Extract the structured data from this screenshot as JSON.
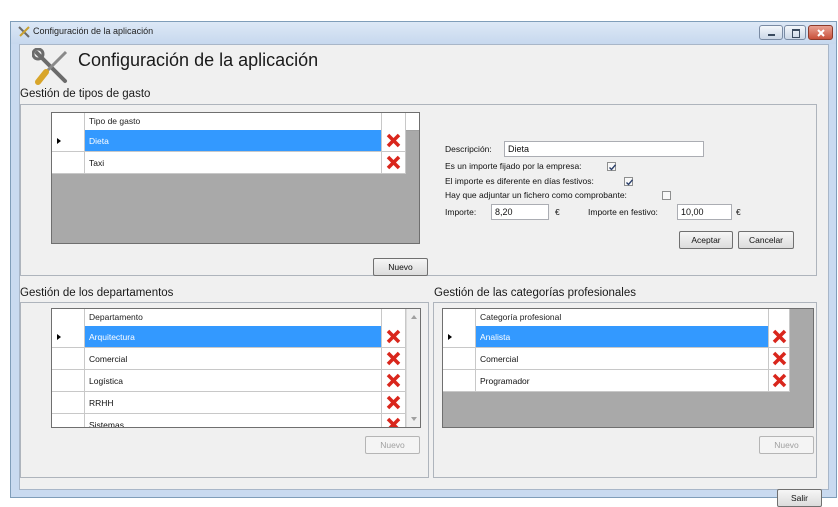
{
  "window": {
    "title": "Configuración de la aplicación",
    "header_title": "Configuración de la aplicación"
  },
  "gastos": {
    "group_title": "Gestión de tipos de gasto",
    "column_header": "Tipo de gasto",
    "rows": [
      "Dieta",
      "Taxi"
    ],
    "selected_row": "Dieta",
    "new_button": "Nuevo"
  },
  "detalle": {
    "descripcion_label": "Descripción:",
    "descripcion_value": "Dieta",
    "fijado_label": "Es un importe fijado por la empresa:",
    "fijado_checked": true,
    "festivos_label": "El importe es diferente en días festivos:",
    "festivos_checked": true,
    "adjuntar_label": "Hay que adjuntar un fichero como comprobante:",
    "adjuntar_checked": false,
    "importe_label": "Importe:",
    "importe_value": "8,20",
    "importe_currency": "€",
    "festivo_label": "Importe en festivo:",
    "festivo_value": "10,00",
    "festivo_currency": "€",
    "accept_button": "Aceptar",
    "cancel_button": "Cancelar"
  },
  "departamentos": {
    "group_title": "Gestión de los departamentos",
    "column_header": "Departamento",
    "rows": [
      "Arquitectura",
      "Comercial",
      "Logística",
      "RRHH",
      "Sistemas"
    ],
    "selected_row": "Arquitectura",
    "new_button": "Nuevo"
  },
  "categorias": {
    "group_title": "Gestión de las categorías profesionales",
    "column_header": "Categoría profesional",
    "rows": [
      "Analista",
      "Comercial",
      "Programador"
    ],
    "selected_row": "Analista",
    "new_button": "Nuevo"
  },
  "footer": {
    "exit_button": "Salir"
  },
  "colors": {
    "selection": "#3399ff",
    "grid_background": "#a9a9a9",
    "delete_red": "#d9261c"
  },
  "icons": {
    "app": "tools-icon",
    "delete": "delete-x-icon",
    "row_pointer": "row-selector-arrow-icon"
  }
}
